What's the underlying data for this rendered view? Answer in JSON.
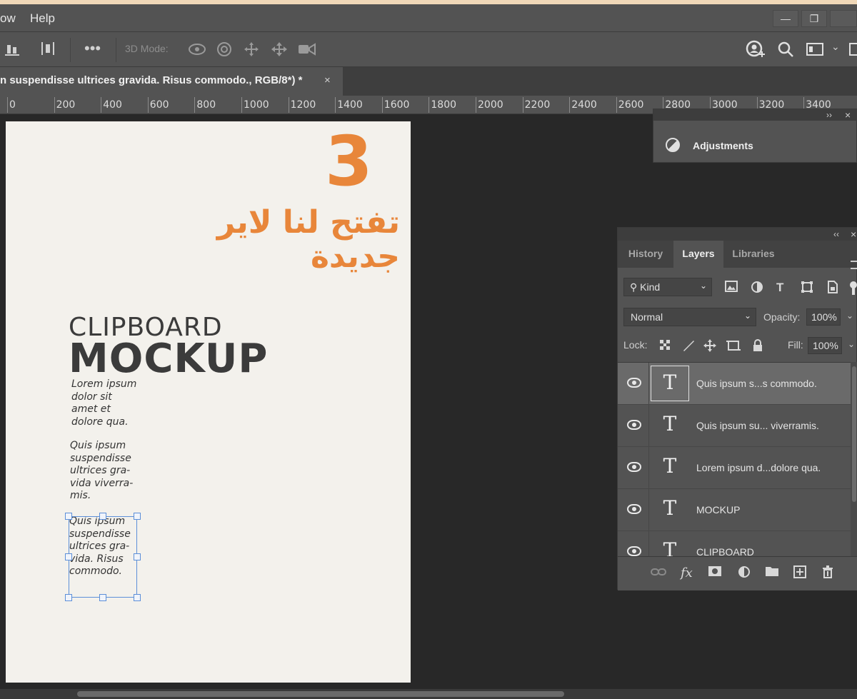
{
  "menubar": {
    "items": [
      "ow",
      "Help"
    ],
    "window_controls": [
      "minimize-icon",
      "restore-icon"
    ]
  },
  "options_bar": {
    "mode_label": "3D Mode:"
  },
  "document_tab": {
    "title": "n suspendisse  ultrices gravida. Risus  commodo., RGB/8*) *",
    "close": "×"
  },
  "ruler": {
    "labels": [
      "0",
      "200",
      "400",
      "600",
      "800",
      "1000",
      "1200",
      "1400",
      "1600",
      "1800",
      "2000",
      "2200",
      "2400",
      "2600",
      "2800",
      "3000",
      "3200",
      "3400"
    ]
  },
  "canvas": {
    "step_number": "3",
    "arabic_caption": "تفتح لنا لاير جديدة",
    "clipboard": "CLIPBOARD",
    "mockup": "MOCKUP",
    "paragraph1": [
      "Lorem ipsum",
      "dolor sit",
      "amet et",
      "dolore qua."
    ],
    "paragraph2": [
      "Quis ipsum",
      "suspendisse",
      "ultrices gra-",
      "vida viverra-",
      "mis."
    ],
    "paragraph3": [
      "Quis ipsum",
      "suspendisse",
      "ultrices gra-",
      "vida. Risus",
      "commodo."
    ]
  },
  "adjustments_panel": {
    "label": "Adjustments",
    "collapse": "››",
    "close": "×"
  },
  "layers_panel": {
    "collapse": "‹‹",
    "close": "×",
    "tabs": [
      {
        "label": "History",
        "active": false
      },
      {
        "label": "Layers",
        "active": true
      },
      {
        "label": "Libraries",
        "active": false
      }
    ],
    "filter_kind": "Kind",
    "blend_mode": "Normal",
    "opacity_label": "Opacity:",
    "opacity_value": "100%",
    "lock_label": "Lock:",
    "fill_label": "Fill:",
    "fill_value": "100%",
    "layers": [
      {
        "name": "Quis ipsum s...s  commodo.",
        "selected": true
      },
      {
        "name": "Quis ipsum su... viverramis.",
        "selected": false
      },
      {
        "name": "Lorem ipsum d...dolore qua.",
        "selected": false
      },
      {
        "name": "MOCKUP",
        "selected": false
      },
      {
        "name": "CLIPBOARD",
        "selected": false
      }
    ],
    "footer_icons": [
      "link-layers-icon",
      "fx-icon",
      "add-mask-icon",
      "adjustment-layer-icon",
      "new-group-icon",
      "new-layer-icon",
      "delete-icon"
    ]
  },
  "colors": {
    "accent_orange": "#e8863a",
    "panel_bg": "#535353",
    "workspace_bg": "#282828",
    "selection_blue": "#5c8fd8"
  }
}
